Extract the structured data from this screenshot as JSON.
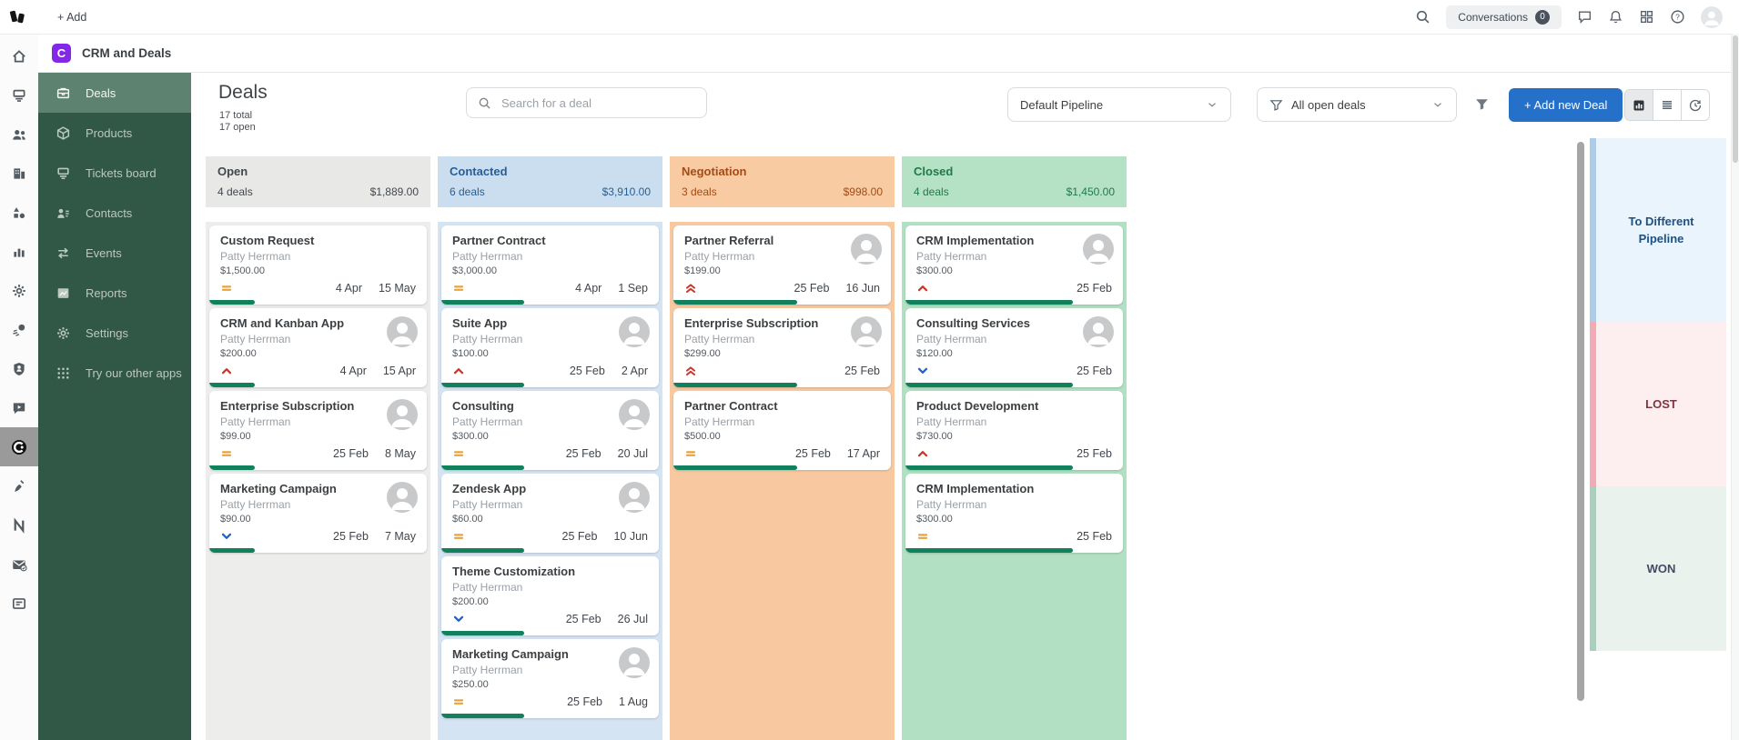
{
  "topbar": {
    "add_label": "+ Add",
    "conversations_label": "Conversations",
    "conversations_count": "0"
  },
  "app_header": {
    "title": "CRM and Deals",
    "app_initial": "C"
  },
  "rail": {
    "items": [
      {
        "name": "home",
        "icon": "home"
      },
      {
        "name": "ticket-stack",
        "icon": "stack"
      },
      {
        "name": "people",
        "icon": "people"
      },
      {
        "name": "building",
        "icon": "building"
      },
      {
        "name": "shapes",
        "icon": "shapes"
      },
      {
        "name": "bar-chart",
        "icon": "bars"
      },
      {
        "name": "gear",
        "icon": "gear"
      },
      {
        "name": "comet",
        "icon": "comet"
      },
      {
        "name": "shield-user",
        "icon": "shield"
      },
      {
        "name": "chat-play",
        "icon": "chatplay"
      },
      {
        "name": "crm-app",
        "icon": "crmring",
        "active": true
      },
      {
        "name": "broom",
        "icon": "broom"
      },
      {
        "name": "letter-n",
        "icon": "letterN"
      },
      {
        "name": "mail-check",
        "icon": "mailcheck"
      },
      {
        "name": "kanban-card",
        "icon": "kanban"
      }
    ]
  },
  "sidebar": {
    "items": [
      {
        "label": "Deals",
        "icon": "briefcase",
        "active": true
      },
      {
        "label": "Products",
        "icon": "cube"
      },
      {
        "label": "Tickets board",
        "icon": "stack"
      },
      {
        "label": "Contacts",
        "icon": "contactcard"
      },
      {
        "label": "Events",
        "icon": "arrows"
      },
      {
        "label": "Reports",
        "icon": "report"
      },
      {
        "label": "Settings",
        "icon": "gear"
      },
      {
        "label": "Try our other apps",
        "icon": "dots9"
      }
    ]
  },
  "toolbar": {
    "title": "Deals",
    "total_label": "17 total",
    "open_label": "17 open",
    "search_placeholder": "Search for a deal",
    "pipeline_select": "Default Pipeline",
    "deals_filter_select": "All open deals",
    "add_deal_label": "+ Add new Deal"
  },
  "board": {
    "columns": [
      {
        "name": "Open",
        "count": "4 deals",
        "sum": "$1,889.00",
        "theme": "open",
        "progress": 21,
        "cards": [
          {
            "title": "Custom Request",
            "owner": "Patty Herrman",
            "amount": "$1,500.00",
            "priority": "medium",
            "start": "4 Apr",
            "end": "15 May",
            "avatar": false
          },
          {
            "title": "CRM and Kanban App",
            "owner": "Patty Herrman",
            "amount": "$200.00",
            "priority": "high",
            "start": "4 Apr",
            "end": "15 Apr",
            "avatar": true
          },
          {
            "title": "Enterprise Subscription",
            "owner": "Patty Herrman",
            "amount": "$99.00",
            "priority": "medium",
            "start": "25 Feb",
            "end": "8 May",
            "avatar": true
          },
          {
            "title": "Marketing Campaign",
            "owner": "Patty Herrman",
            "amount": "$90.00",
            "priority": "low",
            "start": "25 Feb",
            "end": "7 May",
            "avatar": true
          }
        ]
      },
      {
        "name": "Contacted",
        "count": "6 deals",
        "sum": "$3,910.00",
        "theme": "contacted",
        "progress": 38,
        "cards": [
          {
            "title": "Partner Contract",
            "owner": "Patty Herrman",
            "amount": "$3,000.00",
            "priority": "medium",
            "start": "4 Apr",
            "end": "1 Sep",
            "avatar": false
          },
          {
            "title": "Suite App",
            "owner": "Patty Herrman",
            "amount": "$100.00",
            "priority": "high",
            "start": "25 Feb",
            "end": "2 Apr",
            "avatar": true
          },
          {
            "title": "Consulting",
            "owner": "Patty Herrman",
            "amount": "$300.00",
            "priority": "medium",
            "start": "25 Feb",
            "end": "20 Jul",
            "avatar": true
          },
          {
            "title": "Zendesk App",
            "owner": "Patty Herrman",
            "amount": "$60.00",
            "priority": "medium",
            "start": "25 Feb",
            "end": "10 Jun",
            "avatar": true
          },
          {
            "title": "Theme Customization",
            "owner": "Patty Herrman",
            "amount": "$200.00",
            "priority": "low",
            "start": "25 Feb",
            "end": "26 Jul",
            "avatar": false
          },
          {
            "title": "Marketing Campaign",
            "owner": "Patty Herrman",
            "amount": "$250.00",
            "priority": "medium",
            "start": "25 Feb",
            "end": "1 Aug",
            "avatar": true
          }
        ]
      },
      {
        "name": "Negotiation",
        "count": "3 deals",
        "sum": "$998.00",
        "theme": "negotiation",
        "progress": 57,
        "cards": [
          {
            "title": "Partner Referral",
            "owner": "Patty Herrman",
            "amount": "$199.00",
            "priority": "urgent",
            "start": "25 Feb",
            "end": "16 Jun",
            "avatar": true
          },
          {
            "title": "Enterprise Subscription",
            "owner": "Patty Herrman",
            "amount": "$299.00",
            "priority": "urgent",
            "start": "25 Feb",
            "end": "",
            "avatar": true
          },
          {
            "title": "Partner Contract",
            "owner": "Patty Herrman",
            "amount": "$500.00",
            "priority": "medium",
            "start": "25 Feb",
            "end": "17 Apr",
            "avatar": false
          }
        ]
      },
      {
        "name": "Closed",
        "count": "4 deals",
        "sum": "$1,450.00",
        "theme": "closed",
        "progress": 77,
        "cards": [
          {
            "title": "CRM Implementation",
            "owner": "Patty Herrman",
            "amount": "$300.00",
            "priority": "high",
            "start": "25 Feb",
            "end": "",
            "avatar": true
          },
          {
            "title": "Consulting Services",
            "owner": "Patty Herrman",
            "amount": "$120.00",
            "priority": "low",
            "start": "25 Feb",
            "end": "",
            "avatar": true
          },
          {
            "title": "Product Development",
            "owner": "Patty Herrman",
            "amount": "$730.00",
            "priority": "high",
            "start": "25 Feb",
            "end": "",
            "avatar": false
          },
          {
            "title": "CRM Implementation",
            "owner": "Patty Herrman",
            "amount": "$300.00",
            "priority": "medium",
            "start": "25 Feb",
            "end": "",
            "avatar": false
          }
        ]
      }
    ]
  },
  "dropzones": [
    {
      "label": "To Different Pipeline",
      "theme": "pipeline"
    },
    {
      "label": "LOST",
      "theme": "lost"
    },
    {
      "label": "WON",
      "theme": "won"
    }
  ],
  "colors": {
    "accent_blue": "#2570c9",
    "progress_green": "#11805c",
    "sidebar_green": "#315847",
    "sidebar_active": "#5d8370",
    "app_icon_purple": "#8328e8",
    "open_header": "#e8e8e7",
    "contacted_header": "#cbdeef",
    "negotiation_header": "#f8cba3",
    "closed_header": "#b5e2c5",
    "priority_medium": "#e8a33d",
    "priority_high": "#c9372c",
    "priority_low": "#2160c4"
  }
}
